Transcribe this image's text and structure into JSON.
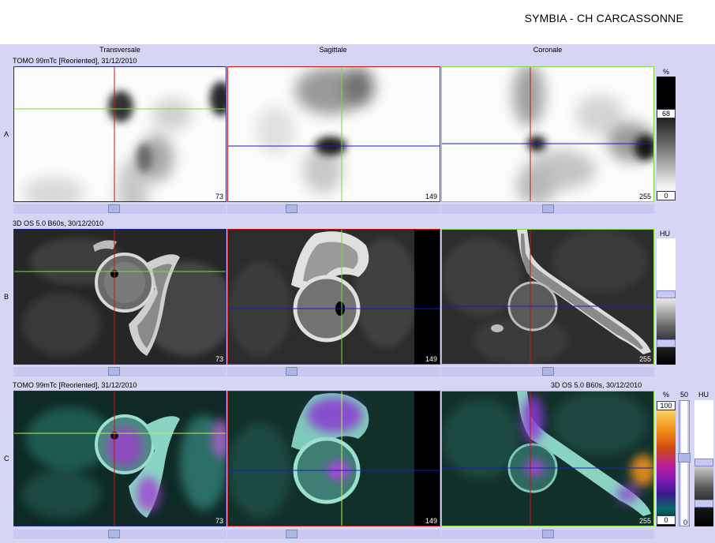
{
  "header": {
    "title": "SYMBIA - CH CARCASSONNE"
  },
  "columns": {
    "transverse": "Transversale",
    "sagittal": "Sagittale",
    "coronal": "Coronale"
  },
  "rows": {
    "a": {
      "letter": "A",
      "label": "TOMO 99mTc [Reoriented], 31/12/2010",
      "numbers": [
        "73",
        "149",
        "255"
      ]
    },
    "b": {
      "letter": "B",
      "label": "3D  OS  5.0  B60s, 30/12/2010",
      "numbers": [
        "73",
        "149",
        "255"
      ]
    },
    "c": {
      "letter": "C",
      "label_left": "TOMO 99mTc [Reoriented], 31/12/2010",
      "label_right": "3D  OS  5.0  B60s, 30/12/2010",
      "numbers": [
        "73",
        "149",
        "255"
      ]
    }
  },
  "scales": {
    "a": {
      "unit": "%",
      "level": "68",
      "min": "0"
    },
    "b": {
      "unit": "HU"
    },
    "c": {
      "unit_pct": "%",
      "max_pct": "100",
      "min_pct": "0",
      "fusion_mid": "50",
      "fusion_min": "0",
      "unit_hu": "HU"
    }
  },
  "colors": {
    "workspace": "#d6d6f4",
    "transverse_border": "#1c2a8c",
    "sagittal_border": "#c01818",
    "coronal_border": "#86d84a",
    "crosshair_red": "#d01010",
    "crosshair_green": "#7adc3c",
    "crosshair_blue": "#1520c0"
  }
}
